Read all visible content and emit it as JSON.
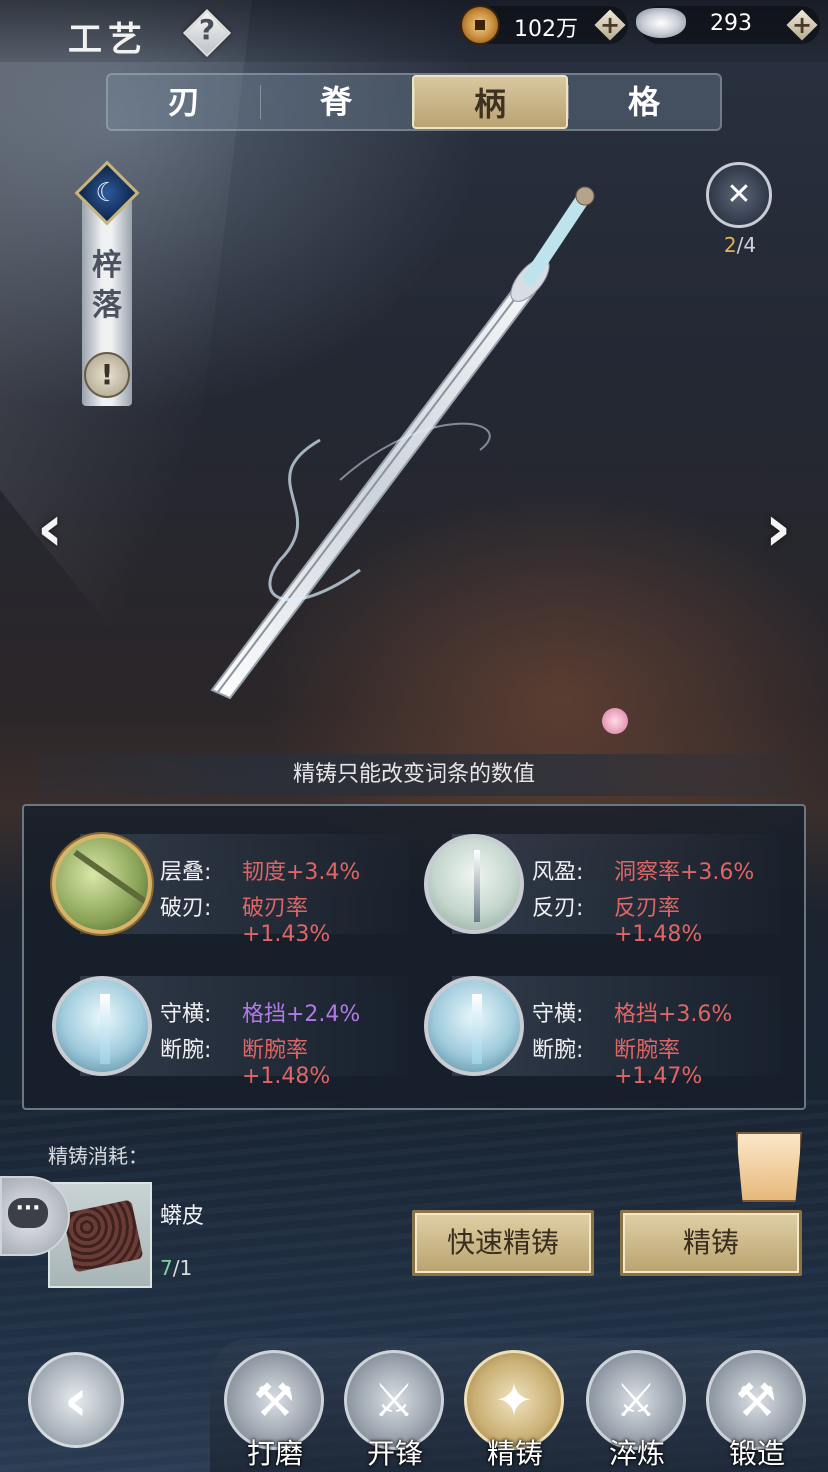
{
  "header": {
    "title": "工艺",
    "help_icon": "?",
    "currencies": [
      {
        "name": "coin-icon",
        "value": "102万"
      },
      {
        "name": "silver-icon",
        "value": "293"
      }
    ],
    "plus": "+"
  },
  "tabs": [
    {
      "label": "刃",
      "active": false
    },
    {
      "label": "脊",
      "active": false
    },
    {
      "label": "柄",
      "active": true
    },
    {
      "label": "格",
      "active": false
    }
  ],
  "weapon": {
    "name": "梓落",
    "alert": "!",
    "moon": "☾"
  },
  "badge": {
    "current": "2",
    "sep": "/",
    "total": "4"
  },
  "nav_arrows": {
    "left": "‹",
    "right": "›"
  },
  "hint": "精铸只能改变词条的数值",
  "stats": [
    {
      "k1": "层叠:",
      "v1": "韧度+3.4%",
      "k2": "破刃:",
      "v2": "破刃率+1.43%"
    },
    {
      "k1": "风盈:",
      "v1": "洞察率+3.6%",
      "k2": "反刃:",
      "v2": "反刃率+1.48%"
    },
    {
      "k1": "守横:",
      "v1": "格挡+2.4%",
      "k2": "断腕:",
      "v2": "断腕率+1.48%"
    },
    {
      "k1": "守横:",
      "v1": "格挡+3.6%",
      "k2": "断腕:",
      "v2": "断腕率+1.47%"
    }
  ],
  "cost": {
    "label": "精铸消耗：",
    "material": "蟒皮",
    "have": "7",
    "sep": "/",
    "need": "1"
  },
  "buttons": {
    "quick_refine": "快速精铸",
    "refine": "精铸"
  },
  "chat_icon": "···",
  "back_icon": "‹",
  "bottom_nav": [
    {
      "label": "打磨",
      "glyph": "⚒",
      "active": false
    },
    {
      "label": "开锋",
      "glyph": "⚔",
      "active": false
    },
    {
      "label": "精铸",
      "glyph": "✦",
      "active": true
    },
    {
      "label": "淬炼",
      "glyph": "⚔",
      "active": false
    },
    {
      "label": "锻造",
      "glyph": "⚒",
      "active": false
    }
  ],
  "colors": {
    "stat_value_red": "#e06565",
    "stat_value_purple": "#b27ae6",
    "gold_accent": "#d9c79f"
  }
}
